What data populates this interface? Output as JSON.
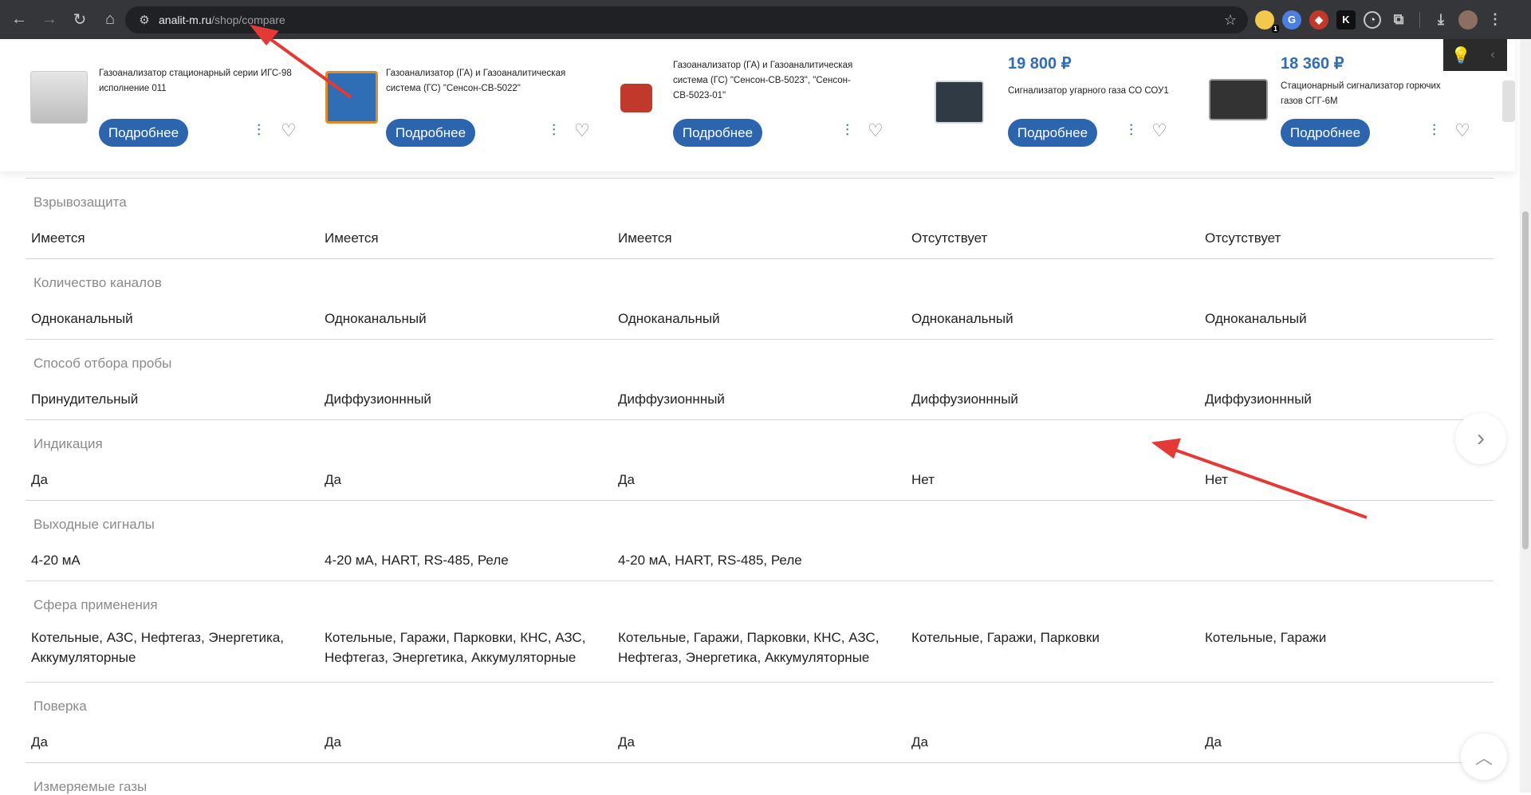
{
  "browser": {
    "url_host": "analit-m.ru",
    "url_path": "/shop/compare",
    "nav": {
      "back_icon": "←",
      "forward_icon": "→",
      "reload_icon": "↻",
      "home_icon": "⌂"
    },
    "ext_badge": "1"
  },
  "products": [
    {
      "title": "Газоанализатор стационарный серии ИГС-98 исполнение 011",
      "price": "",
      "more_label": "Подробнее"
    },
    {
      "title": "Газоанализатор (ГА) и Газоаналитическая система (ГС) \"Сенсон-СВ-5022\"",
      "price": "",
      "more_label": "Подробнее"
    },
    {
      "title": "Газоанализатор (ГА) и Газоаналитическая система (ГС) \"Сенсон-СВ-5023\", \"Сенсон-СВ-5023-01\"",
      "price": "",
      "more_label": "Подробнее"
    },
    {
      "title": "Сигнализатор угарного газа СО СОУ1",
      "price": "19 800 ₽",
      "more_label": "Подробнее"
    },
    {
      "title": "Стационарный сигнализатор горючих газов СГГ-6М",
      "price": "18 360 ₽",
      "more_label": "Подробнее"
    }
  ],
  "specs": [
    {
      "name": "Взрывозащита",
      "values": [
        "Имеется",
        "Имеется",
        "Имеется",
        "Отсутствует",
        "Отсутствует"
      ]
    },
    {
      "name": "Количество каналов",
      "values": [
        "Одноканальный",
        "Одноканальный",
        "Одноканальный",
        "Одноканальный",
        "Одноканальный"
      ]
    },
    {
      "name": "Способ отбора пробы",
      "values": [
        "Принудительный",
        "Диффузионнный",
        "Диффузионнный",
        "Диффузионнный",
        "Диффузионнный"
      ]
    },
    {
      "name": "Индикация",
      "values": [
        "Да",
        "Да",
        "Да",
        "Нет",
        "Нет"
      ]
    },
    {
      "name": "Выходные сигналы",
      "values": [
        "4-20 мА",
        "4-20 мА, HART, RS-485, Реле",
        "4-20 мА, HART, RS-485, Реле",
        "",
        ""
      ]
    },
    {
      "name": "Сфера применения",
      "values": [
        "Котельные, АЗС, Нефтегаз, Энергетика, Аккумуляторные",
        "Котельные, Гаражи, Парковки, КНС, АЗС, Нефтегаз, Энергетика, Аккумуляторные",
        "Котельные, Гаражи, Парковки, КНС, АЗС, Нефтегаз, Энергетика, Аккумуляторные",
        "Котельные, Гаражи, Парковки",
        "Котельные, Гаражи"
      ]
    },
    {
      "name": "Поверка",
      "values": [
        "Да",
        "Да",
        "Да",
        "Да",
        "Да"
      ]
    },
    {
      "name": "Измеряемые газы",
      "values": []
    }
  ],
  "colors": {
    "accent": "#2c64ae",
    "price": "#2f6db5",
    "annotation_arrow": "#e53935"
  }
}
